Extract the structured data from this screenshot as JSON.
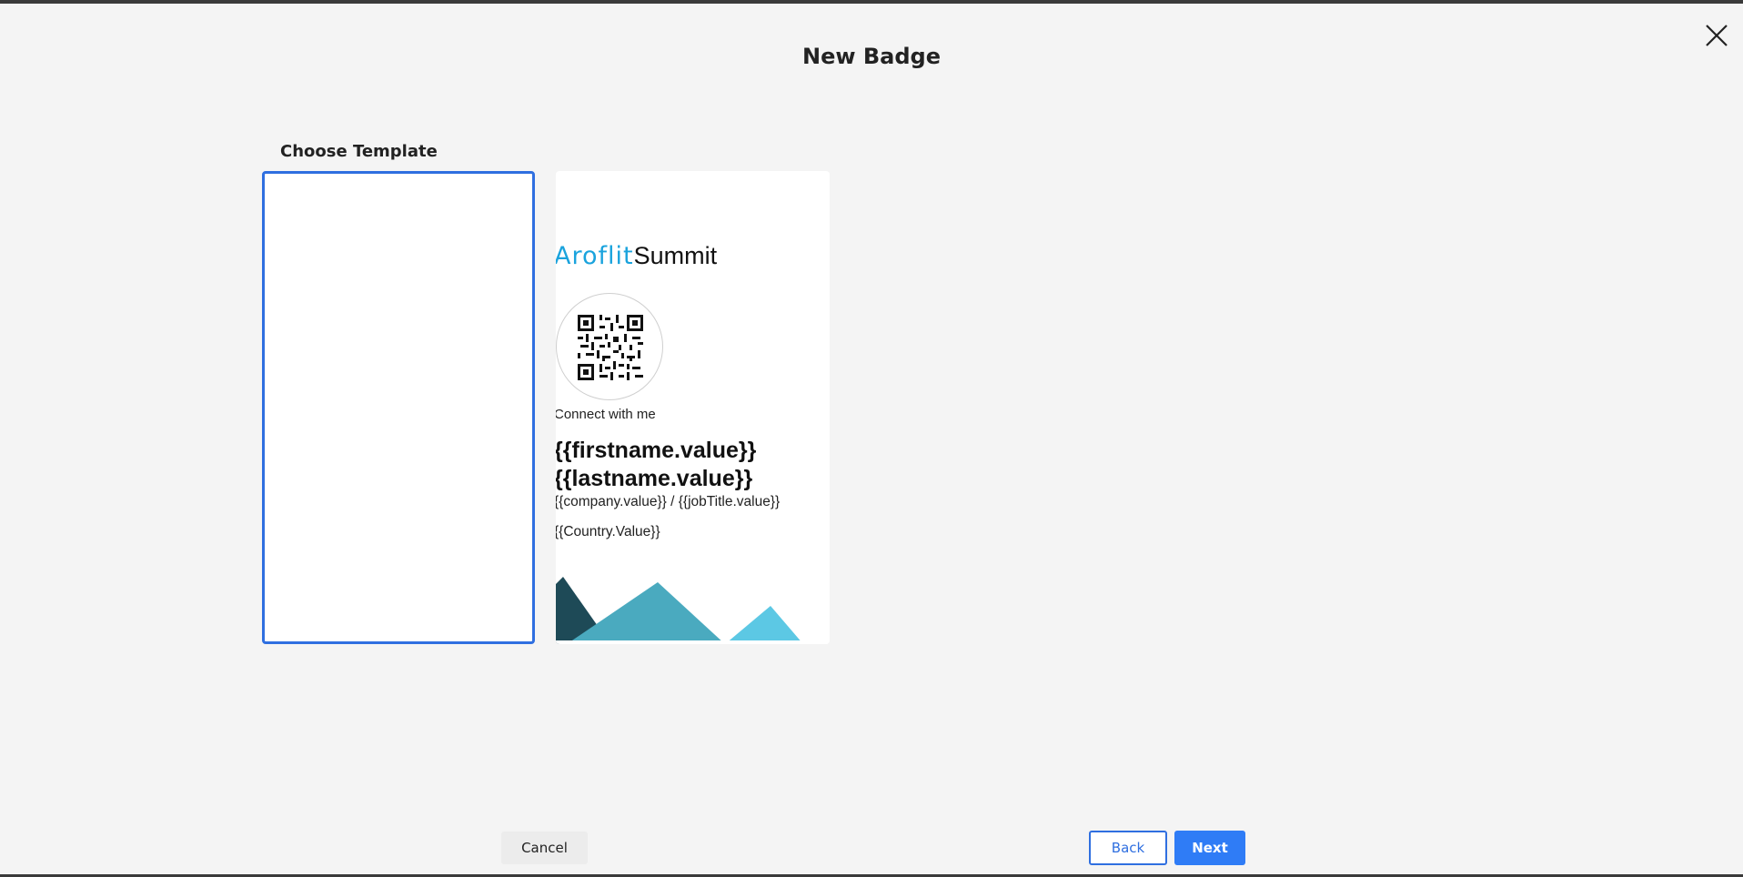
{
  "modal": {
    "title": "New Badge",
    "close_icon": "close-icon"
  },
  "template_picker": {
    "label": "Choose Template",
    "selected_color": "#2f6fe0",
    "templates": [
      {
        "id": "blank"
      },
      {
        "id": "summit",
        "brand": "Aroflit",
        "event": "Summit",
        "brand_color": "#1aa3dd",
        "connect": "Connect with me",
        "firstname": "{{firstname.value}}",
        "lastname": "{{lastname.value}}",
        "company_job": "{{company.value}} / {{jobTitle.value}}",
        "country": "{{Country.Value}}"
      }
    ]
  },
  "footer": {
    "cancel": "Cancel",
    "back": "Back",
    "next": "Next",
    "accent": "#2f7cf6"
  }
}
